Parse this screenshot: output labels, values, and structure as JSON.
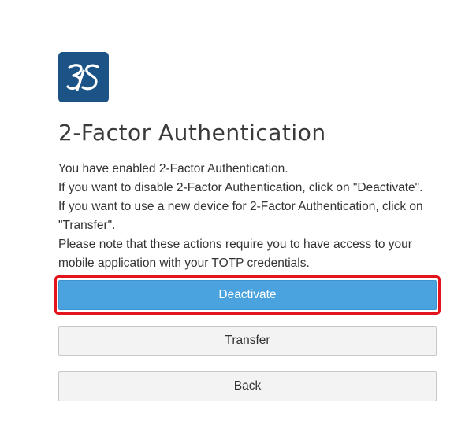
{
  "brand": {
    "logo_icon": "3ds-logo-icon",
    "logo_color": "#1b5387"
  },
  "header": {
    "title": "2-Factor Authentication"
  },
  "message": {
    "lines": [
      "You have enabled 2-Factor Authentication.",
      "If you want to disable 2-Factor Authentication, click on \"Deactivate\".",
      "If you want to use a new device for 2-Factor Authentication, click on",
      "\"Transfer\".",
      "Please note that these actions require you to have access to your",
      "mobile application with your TOTP credentials."
    ]
  },
  "actions": {
    "deactivate_label": "Deactivate",
    "transfer_label": "Transfer",
    "back_label": "Back"
  },
  "colors": {
    "primary": "#4aa3de",
    "highlight": "#e3141e",
    "secondary_bg": "#f3f3f3"
  }
}
